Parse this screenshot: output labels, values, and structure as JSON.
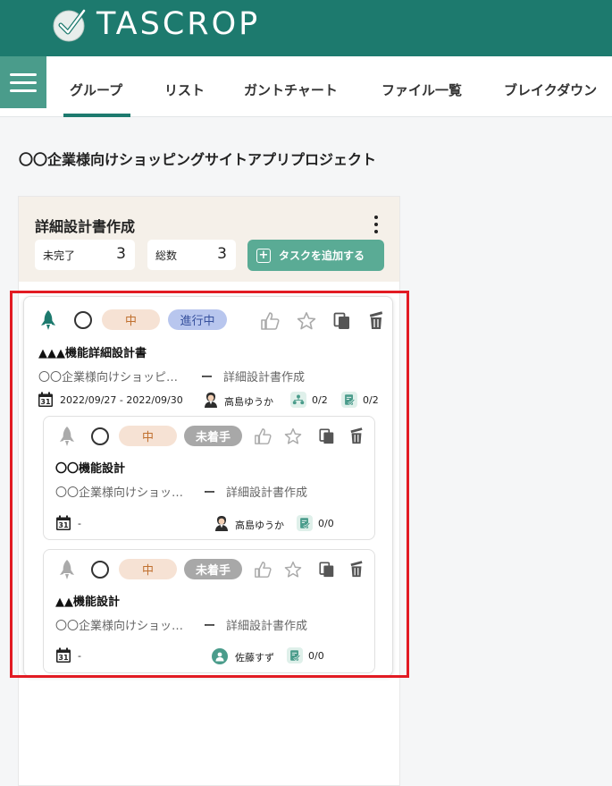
{
  "app": {
    "logo_text": "TASCROP"
  },
  "nav": {
    "tabs": [
      "グループ",
      "リスト",
      "ガントチャート",
      "ファイル一覧",
      "ブレイクダウン"
    ]
  },
  "project": {
    "title": "〇〇企業様向けショッピングサイトアプリプロジェクト"
  },
  "group": {
    "title": "詳細設計書作成",
    "incomplete_label": "未完了",
    "incomplete_count": "3",
    "total_label": "総数",
    "total_count": "3",
    "add_task_label": "タスクを追加する"
  },
  "tasks": [
    {
      "priority": "中",
      "status": "進行中",
      "name": "▲▲▲機能詳細設計書",
      "project": "〇〇企業様向けショッピ…",
      "separator": "ー",
      "group": "詳細設計書作成",
      "date": "2022/09/27 - 2022/09/30",
      "assignee": "高島ゆうか",
      "subtasks": "0/2",
      "checklist": "0/2"
    },
    {
      "priority": "中",
      "status": "未着手",
      "name": "〇〇機能設計",
      "project": "〇〇企業様向けショッ…",
      "separator": "ー",
      "group": "詳細設計書作成",
      "date": "-",
      "assignee": "高島ゆうか",
      "checklist": "0/0"
    },
    {
      "priority": "中",
      "status": "未着手",
      "name": "▲▲機能設計",
      "project": "〇〇企業様向けショッ…",
      "separator": "ー",
      "group": "詳細設計書作成",
      "date": "-",
      "assignee": "佐藤すず",
      "checklist": "0/0"
    }
  ],
  "colors": {
    "brand": "#1d7a6e",
    "accent": "#5aab95",
    "highlight": "#e21b23",
    "priority_bg": "#f6e2d4",
    "in_progress_bg": "#b8c6ee",
    "not_started_bg": "#a8a8a8"
  }
}
